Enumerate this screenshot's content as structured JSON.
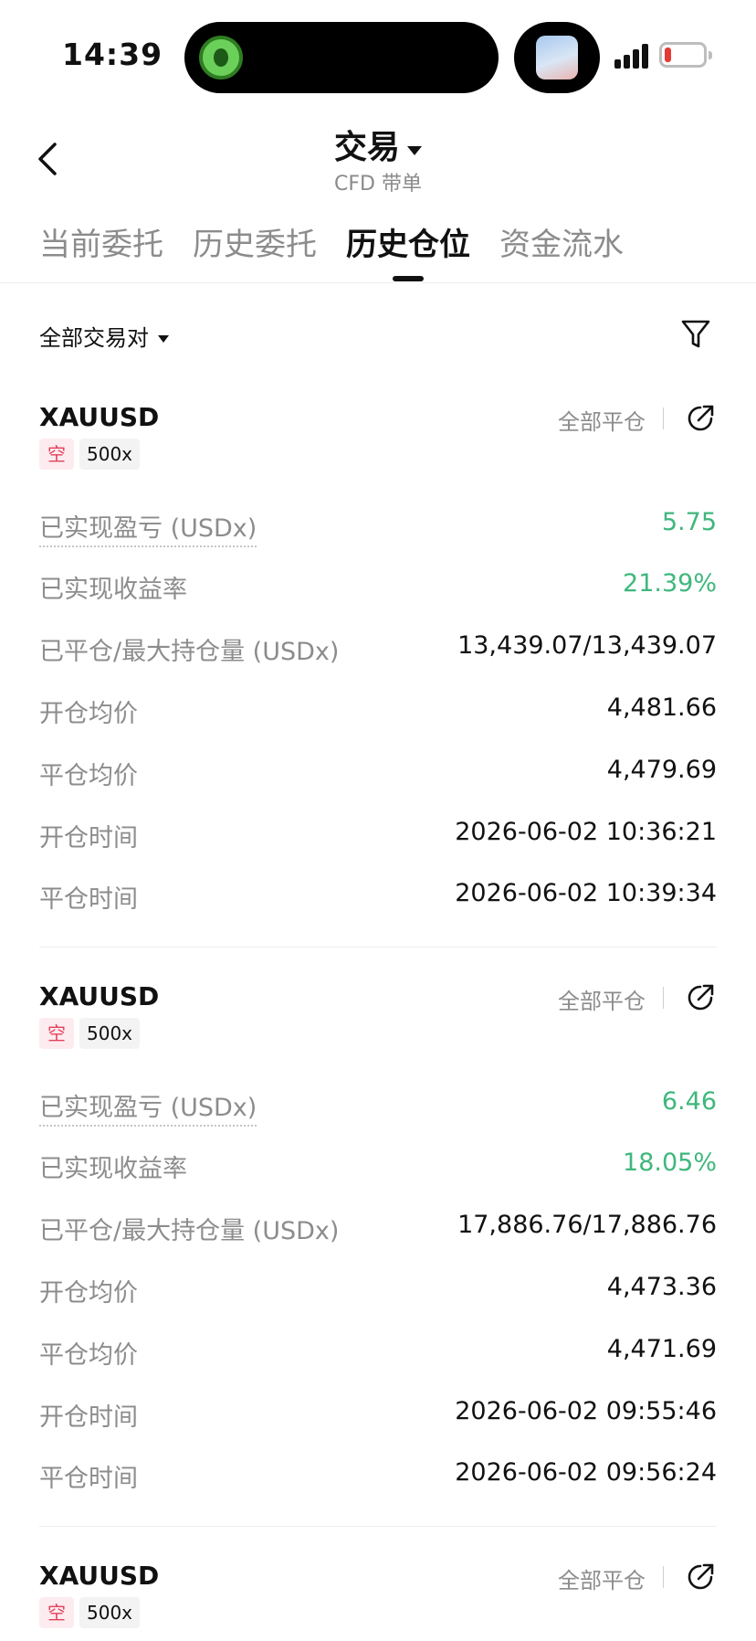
{
  "status_bar": {
    "time": "14:39"
  },
  "header": {
    "title": "交易",
    "subtitle": "CFD 带单"
  },
  "tabs": [
    {
      "label": "当前委托",
      "active": false
    },
    {
      "label": "历史委托",
      "active": false
    },
    {
      "label": "历史仓位",
      "active": true
    },
    {
      "label": "资金流水",
      "active": false
    }
  ],
  "filter": {
    "pair_label": "全部交易对"
  },
  "colors": {
    "profit_green": "#3fb77c",
    "short_red": "#e2415c"
  },
  "records": [
    {
      "symbol": "XAUUSD",
      "close_all": "全部平仓",
      "side": "空",
      "leverage": "500x",
      "rows": [
        {
          "label": "已实现盈亏 (USDx)",
          "value": "5.75"
        },
        {
          "label": "已实现收益率",
          "value": "21.39%"
        },
        {
          "label": "已平仓/最大持仓量 (USDx)",
          "value": "13,439.07/13,439.07"
        },
        {
          "label": "开仓均价",
          "value": "4,481.66"
        },
        {
          "label": "平仓均价",
          "value": "4,479.69"
        },
        {
          "label": "开仓时间",
          "value": "2026-06-02 10:36:21"
        },
        {
          "label": "平仓时间",
          "value": "2026-06-02 10:39:34"
        }
      ]
    },
    {
      "symbol": "XAUUSD",
      "close_all": "全部平仓",
      "side": "空",
      "leverage": "500x",
      "rows": [
        {
          "label": "已实现盈亏 (USDx)",
          "value": "6.46"
        },
        {
          "label": "已实现收益率",
          "value": "18.05%"
        },
        {
          "label": "已平仓/最大持仓量 (USDx)",
          "value": "17,886.76/17,886.76"
        },
        {
          "label": "开仓均价",
          "value": "4,473.36"
        },
        {
          "label": "平仓均价",
          "value": "4,471.69"
        },
        {
          "label": "开仓时间",
          "value": "2026-06-02 09:55:46"
        },
        {
          "label": "平仓时间",
          "value": "2026-06-02 09:56:24"
        }
      ]
    },
    {
      "symbol": "XAUUSD",
      "close_all": "全部平仓",
      "side": "空",
      "leverage": "500x"
    }
  ]
}
